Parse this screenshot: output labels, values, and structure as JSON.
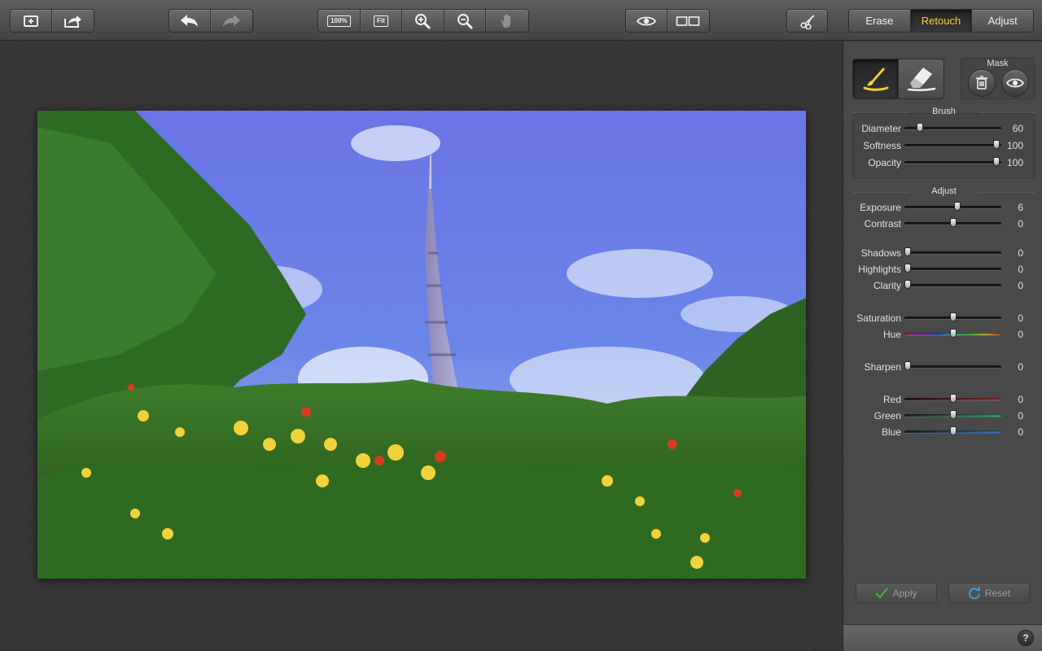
{
  "toolbar": {
    "groups": [
      {
        "buttons": [
          {
            "icon": "open-file-icon"
          },
          {
            "icon": "share-export-icon"
          }
        ]
      },
      {
        "buttons": [
          {
            "icon": "undo-icon"
          },
          {
            "icon": "redo-icon",
            "disabled": true
          }
        ]
      },
      {
        "buttons": [
          {
            "icon": "zoom-actual-icon",
            "label": "100%"
          },
          {
            "icon": "zoom-fit-icon",
            "label": "Fit"
          },
          {
            "icon": "zoom-in-icon"
          },
          {
            "icon": "zoom-out-icon"
          },
          {
            "icon": "hand-pan-icon",
            "disabled": true
          }
        ]
      },
      {
        "buttons": [
          {
            "icon": "preview-eye-icon"
          },
          {
            "icon": "split-compare-icon"
          }
        ]
      },
      {
        "buttons": [
          {
            "icon": "crop-scissors-icon"
          }
        ]
      }
    ],
    "zoom_actual_label": "100%",
    "zoom_fit_label": "Fit",
    "mode_tabs": [
      {
        "label": "Erase",
        "active": false
      },
      {
        "label": "Retouch",
        "active": true
      },
      {
        "label": "Adjust",
        "active": false
      }
    ],
    "accent_color": "#f2d23a"
  },
  "canvas": {
    "photo_icon": "photo-tower-landscape"
  },
  "panel": {
    "tools": [
      {
        "icon": "brush-icon",
        "active": true
      },
      {
        "icon": "eraser-icon",
        "active": false
      }
    ],
    "mask": {
      "label": "Mask",
      "buttons": [
        {
          "icon": "trash-icon"
        },
        {
          "icon": "mask-eye-icon"
        }
      ]
    },
    "brush": {
      "title": "Brush",
      "sliders": [
        {
          "label": "Diameter",
          "value": "60",
          "fraction": 0.16
        },
        {
          "label": "Softness",
          "value": "100",
          "fraction": 0.95
        },
        {
          "label": "Opacity",
          "value": "100",
          "fraction": 0.95
        }
      ]
    },
    "adjust": {
      "title": "Adjust",
      "groups": [
        [
          {
            "label": "Exposure",
            "value": "6",
            "fraction": 0.55
          },
          {
            "label": "Contrast",
            "value": "0",
            "fraction": 0.5
          }
        ],
        [
          {
            "label": "Shadows",
            "value": "0",
            "fraction": 0.03
          },
          {
            "label": "Highlights",
            "value": "0",
            "fraction": 0.03
          },
          {
            "label": "Clarity",
            "value": "0",
            "fraction": 0.03
          }
        ],
        [
          {
            "label": "Saturation",
            "value": "0",
            "fraction": 0.5
          },
          {
            "label": "Hue",
            "value": "0",
            "fraction": 0.5,
            "track": "hue"
          }
        ],
        [
          {
            "label": "Sharpen",
            "value": "0",
            "fraction": 0.03
          }
        ],
        [
          {
            "label": "Red",
            "value": "0",
            "fraction": 0.5,
            "track": "red"
          },
          {
            "label": "Green",
            "value": "0",
            "fraction": 0.5,
            "track": "green"
          },
          {
            "label": "Blue",
            "value": "0",
            "fraction": 0.5,
            "track": "blue"
          }
        ]
      ]
    },
    "apply_label": "Apply",
    "reset_label": "Reset",
    "help_label": "?"
  }
}
